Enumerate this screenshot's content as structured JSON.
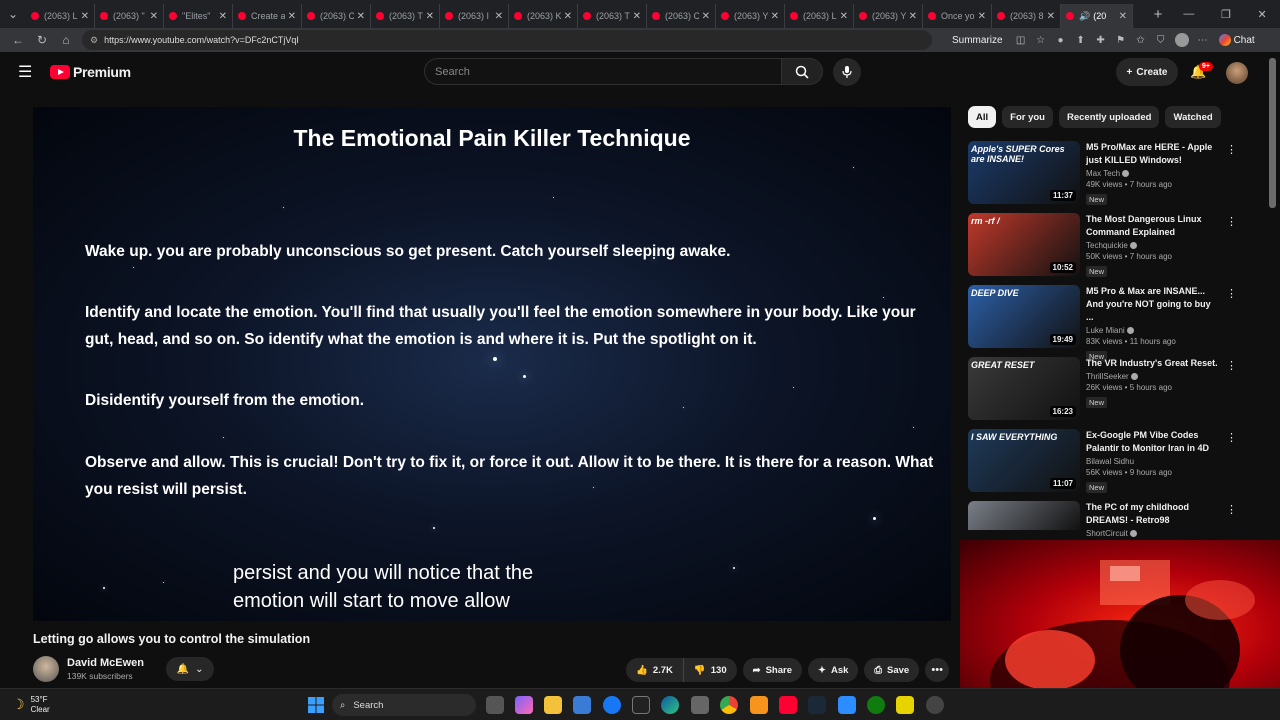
{
  "browser": {
    "tabs": [
      {
        "label": "(2063) L"
      },
      {
        "label": "(2063) \""
      },
      {
        "label": "\"Elites\" "
      },
      {
        "label": "Create a"
      },
      {
        "label": "(2063) C"
      },
      {
        "label": "(2063) T"
      },
      {
        "label": "(2063) I"
      },
      {
        "label": "(2063) K"
      },
      {
        "label": "(2063) T"
      },
      {
        "label": "(2063) C"
      },
      {
        "label": "(2063) Y"
      },
      {
        "label": "(2063) L"
      },
      {
        "label": "(2063) Y"
      },
      {
        "label": "Once yo"
      },
      {
        "label": "(2063) 8"
      },
      {
        "label": "(20"
      }
    ],
    "url": "https://www.youtube.com/watch?v=DFc2nCTjVqI",
    "summarize_label": "Summarize",
    "chat_label": "Chat"
  },
  "youtube": {
    "logo_text": "Premium",
    "search_placeholder": "Search",
    "create_label": "Create",
    "notif_badge": "9+"
  },
  "video": {
    "slide_title": "The Emotional Pain Killer Technique",
    "lines": [
      "Wake up. you are probably unconscious so get present. Catch yourself sleeping awake.",
      "Identify and locate the emotion. You'll find that usually you'll feel the emotion somewhere in your body. Like your gut, head, and so on. So identify what the emotion is and where it is. Put the spotlight on it.",
      "Disidentify yourself from the emotion.",
      "Observe and allow. This is crucial! Don't try to fix it, or force it out. Allow it to be there. It is there for a reason. What you resist will persist."
    ],
    "caption_line1": "persist and you will notice that the",
    "caption_line2": "emotion will start to move allow",
    "title": "Letting go allows you to control the simulation",
    "channel_name": "David McEwen",
    "subscribers": "139K subscribers",
    "likes": "2.7K",
    "dislikes": "130",
    "share_label": "Share",
    "ask_label": "Ask",
    "save_label": "Save"
  },
  "chips": [
    "All",
    "For you",
    "Recently uploaded",
    "Watched"
  ],
  "recommendations": [
    {
      "title": "M5 Pro/Max are HERE - Apple just KILLED Windows!",
      "channel": "Max Tech",
      "verified": true,
      "views": "49K views • 7 hours ago",
      "badge": "New",
      "duration": "11:37",
      "thumb_text": "Apple's SUPER Cores are INSANE!",
      "thumb_color": "#1b3b6b"
    },
    {
      "title": "The Most Dangerous Linux Command Explained",
      "channel": "Techquickie",
      "verified": true,
      "views": "50K views • 7 hours ago",
      "badge": "New",
      "duration": "10:52",
      "thumb_text": "rm -rf /",
      "thumb_color": "#c0392b"
    },
    {
      "title": "M5 Pro & Max are INSANE... And you're NOT going to buy ...",
      "channel": "Luke Miani",
      "verified": true,
      "views": "83K views • 11 hours ago",
      "badge": "New",
      "duration": "19:49",
      "thumb_text": "DEEP DIVE",
      "thumb_color": "#2c5fa8"
    },
    {
      "title": "The VR Industry's Great Reset.",
      "channel": "ThrillSeeker",
      "verified": true,
      "views": "26K views • 5 hours ago",
      "badge": "New",
      "duration": "16:23",
      "thumb_text": "GREAT RESET",
      "thumb_color": "#3a3a3a"
    },
    {
      "title": "Ex-Google PM Vibe Codes Palantir to Monitor Iran in 4D",
      "channel": "Bilawal Sidhu",
      "verified": false,
      "views": "56K views • 9 hours ago",
      "badge": "New",
      "duration": "11:07",
      "thumb_text": "I SAW EVERYTHING",
      "thumb_color": "#1e3a5a"
    },
    {
      "title": "The PC of my childhood DREAMS! - Retro98",
      "channel": "ShortCircuit",
      "verified": true,
      "views": "",
      "badge": "",
      "duration": "",
      "thumb_text": "",
      "thumb_color": "#7a7f88"
    }
  ],
  "taskbar": {
    "temp": "53°F",
    "condition": "Clear",
    "search_label": "Search"
  }
}
